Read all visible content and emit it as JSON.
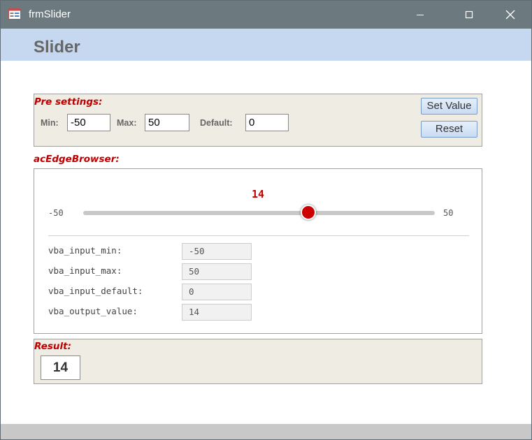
{
  "window": {
    "title": "frmSlider"
  },
  "form": {
    "title": "Slider"
  },
  "presettings": {
    "label": "Pre settings:",
    "min_label": "Min:",
    "min_value": "-50",
    "max_label": "Max:",
    "max_value": "50",
    "default_label": "Default:",
    "default_value": "0",
    "set_value_button": "Set Value",
    "reset_button": "Reset"
  },
  "browser": {
    "label": "acEdgeBrowser:",
    "slider": {
      "value": "14",
      "min": "-50",
      "max": "50",
      "position_fraction": 0.64
    },
    "vars": [
      {
        "name": "vba_input_min:",
        "value": "-50"
      },
      {
        "name": "vba_input_max:",
        "value": "50"
      },
      {
        "name": "vba_input_default:",
        "value": "0"
      },
      {
        "name": "vba_output_value:",
        "value": "14"
      }
    ]
  },
  "result": {
    "label": "Result:",
    "value": "14"
  },
  "colors": {
    "accent_red": "#c00000",
    "header_bg": "#c5d8ef",
    "titlebar_bg": "#6c7a80",
    "panel_bg": "#efece3"
  }
}
